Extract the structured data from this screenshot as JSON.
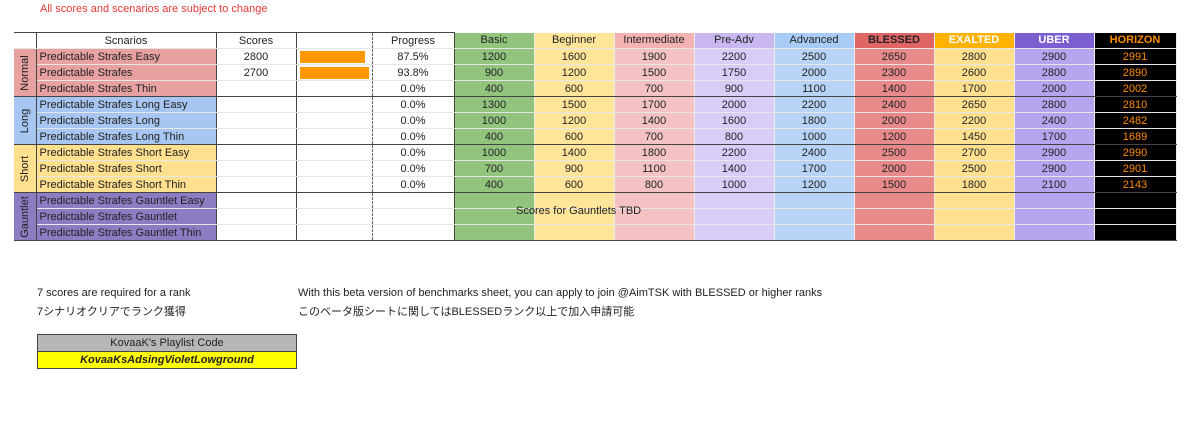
{
  "top_note": "All scores and scenarios are subject to change",
  "headers": {
    "scenarios": "Scnarios",
    "scores": "Scores",
    "progress": "Progress",
    "ranks": [
      "Basic",
      "Beginner",
      "Intermediate",
      "Pre-Adv",
      "Advanced",
      "BLESSED",
      "EXALTED",
      "UBER",
      "HORIZON"
    ]
  },
  "rank_header_colors": [
    "#93c47d",
    "#ffe599",
    "#f4b3b3",
    "#c9b7f0",
    "#a8ccf5",
    "#e06666",
    "#ffb300",
    "#7b5fd0",
    "#000000"
  ],
  "rank_header_text_colors": [
    "#222222",
    "#222222",
    "#222222",
    "#222222",
    "#222222",
    "#222222",
    "#ffffff",
    "#ffffff",
    "#ff8c00"
  ],
  "rank_col_colors": [
    "#93c47d",
    "#ffe599",
    "#f4c2c2",
    "#d9ccf7",
    "#b7d3f5",
    "#e88a8a",
    "#ffe08f",
    "#b6a4ef",
    "#000000"
  ],
  "groups": [
    {
      "name": "Normal",
      "color": "#e8a1a1",
      "rows": [
        {
          "scenario": "Predictable Strafes Easy",
          "score": "2800",
          "progress": "87.5%",
          "bar": 0.875,
          "ranks": [
            "1200",
            "1600",
            "1900",
            "2200",
            "2500",
            "2650",
            "2800",
            "2900",
            "2991"
          ]
        },
        {
          "scenario": "Predictable Strafes",
          "score": "2700",
          "progress": "93.8%",
          "bar": 0.938,
          "ranks": [
            "900",
            "1200",
            "1500",
            "1750",
            "2000",
            "2300",
            "2600",
            "2800",
            "2890"
          ]
        },
        {
          "scenario": "Predictable Strafes Thin",
          "score": "",
          "progress": "0.0%",
          "bar": 0,
          "ranks": [
            "400",
            "600",
            "700",
            "900",
            "1100",
            "1400",
            "1700",
            "2000",
            "2002"
          ]
        }
      ]
    },
    {
      "name": "Long",
      "color": "#a7c7f2",
      "rows": [
        {
          "scenario": "Predictable Strafes Long Easy",
          "score": "",
          "progress": "0.0%",
          "bar": 0,
          "ranks": [
            "1300",
            "1500",
            "1700",
            "2000",
            "2200",
            "2400",
            "2650",
            "2800",
            "2810"
          ]
        },
        {
          "scenario": "Predictable Strafes Long",
          "score": "",
          "progress": "0.0%",
          "bar": 0,
          "ranks": [
            "1000",
            "1200",
            "1400",
            "1600",
            "1800",
            "2000",
            "2200",
            "2400",
            "2482"
          ]
        },
        {
          "scenario": "Predictable Strafes Long Thin",
          "score": "",
          "progress": "0.0%",
          "bar": 0,
          "ranks": [
            "400",
            "600",
            "700",
            "800",
            "1000",
            "1200",
            "1450",
            "1700",
            "1689"
          ]
        }
      ]
    },
    {
      "name": "Short",
      "color": "#ffe08f",
      "rows": [
        {
          "scenario": "Predictable Strafes Short Easy",
          "score": "",
          "progress": "0.0%",
          "bar": 0,
          "ranks": [
            "1000",
            "1400",
            "1800",
            "2200",
            "2400",
            "2500",
            "2700",
            "2900",
            "2990"
          ]
        },
        {
          "scenario": "Predictable Strafes Short",
          "score": "",
          "progress": "0.0%",
          "bar": 0,
          "ranks": [
            "700",
            "900",
            "1100",
            "1400",
            "1700",
            "2000",
            "2500",
            "2900",
            "2901"
          ]
        },
        {
          "scenario": "Predictable Strafes Short Thin",
          "score": "",
          "progress": "0.0%",
          "bar": 0,
          "ranks": [
            "400",
            "600",
            "800",
            "1000",
            "1200",
            "1500",
            "1800",
            "2100",
            "2143"
          ]
        }
      ]
    },
    {
      "name": "Gauntlet",
      "color": "#8e7cc3",
      "rows": [
        {
          "scenario": "Predictable Strafes Gauntlet Easy",
          "score": "",
          "progress": "",
          "bar": 0,
          "ranks": [
            "",
            "",
            "",
            "",
            "",
            "",
            "",
            "",
            ""
          ]
        },
        {
          "scenario": "Predictable Strafes Gauntlet",
          "score": "",
          "progress": "",
          "bar": 0,
          "ranks": [
            "",
            "",
            "",
            "",
            "",
            "",
            "",
            "",
            ""
          ]
        },
        {
          "scenario": "Predictable Strafes Gauntlet Thin",
          "score": "",
          "progress": "",
          "bar": 0,
          "ranks": [
            "",
            "",
            "",
            "",
            "",
            "",
            "",
            "",
            ""
          ]
        }
      ]
    }
  ],
  "gauntlet_note": "Scores for Gauntlets TBD",
  "notes": {
    "rank_req_en": "7 scores are required for a rank",
    "rank_req_jp": "7シナリオクリアでランク獲得",
    "beta_en": "With this beta version of benchmarks sheet, you can apply to join @AimTSK with BLESSED or higher ranks",
    "beta_jp": "このベータ版シートに関してはBLESSEDランク以上で加入申請可能"
  },
  "playlist": {
    "label": "KovaaK's Playlist Code",
    "code": "KovaaKsAdsingVioletLowground"
  }
}
